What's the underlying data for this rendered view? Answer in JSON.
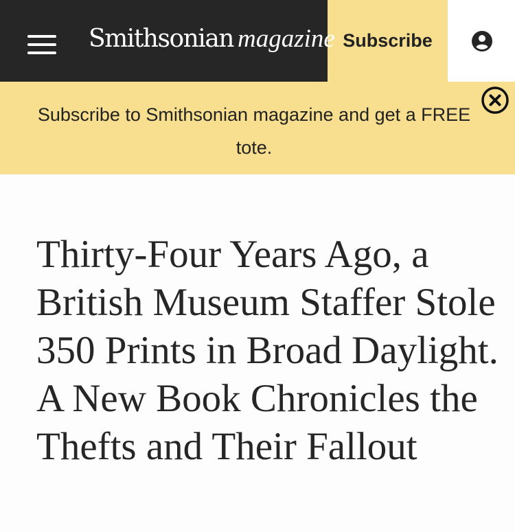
{
  "header": {
    "logo_main": "Smithsonian",
    "logo_sub": "magazine",
    "subscribe_label": "Subscribe",
    "dark_color": "#262626",
    "accent_color": "#f8df8f",
    "menu_icon": "hamburger-menu-icon",
    "account_icon": "user-account-icon"
  },
  "promo": {
    "text": "Subscribe to Smithsonian magazine and get a FREE tote.",
    "close_icon": "close-icon"
  },
  "article": {
    "headline": "Thirty-Four Years Ago, a British Museum Staffer Stole 350 Prints in Broad Daylight. A New Book Chronicles the Thefts and Their Fallout"
  }
}
